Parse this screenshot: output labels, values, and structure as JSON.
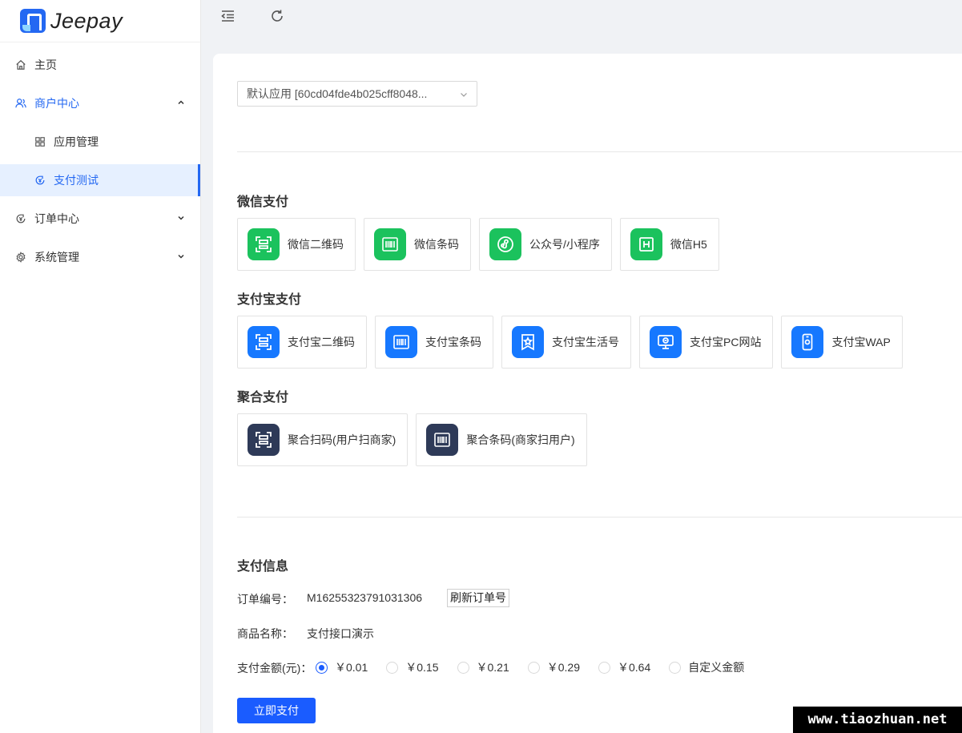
{
  "logo": {
    "text": "Jeepay"
  },
  "sidebar": {
    "items": [
      {
        "label": "主页"
      },
      {
        "label": "商户中心"
      },
      {
        "label": "应用管理"
      },
      {
        "label": "支付测试"
      },
      {
        "label": "订单中心"
      },
      {
        "label": "系统管理"
      }
    ]
  },
  "app_select": {
    "value": "默认应用 [60cd04fde4b025cff8048..."
  },
  "sections": {
    "wechat": {
      "title": "微信支付",
      "ways": [
        {
          "label": "微信二维码"
        },
        {
          "label": "微信条码"
        },
        {
          "label": "公众号/小程序"
        },
        {
          "label": "微信H5"
        }
      ]
    },
    "alipay": {
      "title": "支付宝支付",
      "ways": [
        {
          "label": "支付宝二维码"
        },
        {
          "label": "支付宝条码"
        },
        {
          "label": "支付宝生活号"
        },
        {
          "label": "支付宝PC网站"
        },
        {
          "label": "支付宝WAP"
        }
      ]
    },
    "aggregate": {
      "title": "聚合支付",
      "ways": [
        {
          "label": "聚合扫码(用户扫商家)"
        },
        {
          "label": "聚合条码(商家扫用户)"
        }
      ]
    }
  },
  "pay_info": {
    "title": "支付信息",
    "order_no_label": "订单编号：",
    "order_no": "M16255323791031306",
    "refresh_label": "刷新订单号",
    "product_label": "商品名称：",
    "product": "支付接口演示",
    "amount_label": "支付金额(元)：",
    "amounts": [
      {
        "label": "￥0.01",
        "checked": true
      },
      {
        "label": "￥0.15"
      },
      {
        "label": "￥0.21"
      },
      {
        "label": "￥0.29"
      },
      {
        "label": "￥0.64"
      },
      {
        "label": "自定义金额"
      }
    ],
    "pay_button": "立即支付"
  },
  "colors": {
    "primary": "#1a5cff",
    "wechat": "#1bc25d",
    "alipay": "#1678ff",
    "aggregate": "#2e3a58"
  },
  "watermark": "www.tiaozhuan.net"
}
